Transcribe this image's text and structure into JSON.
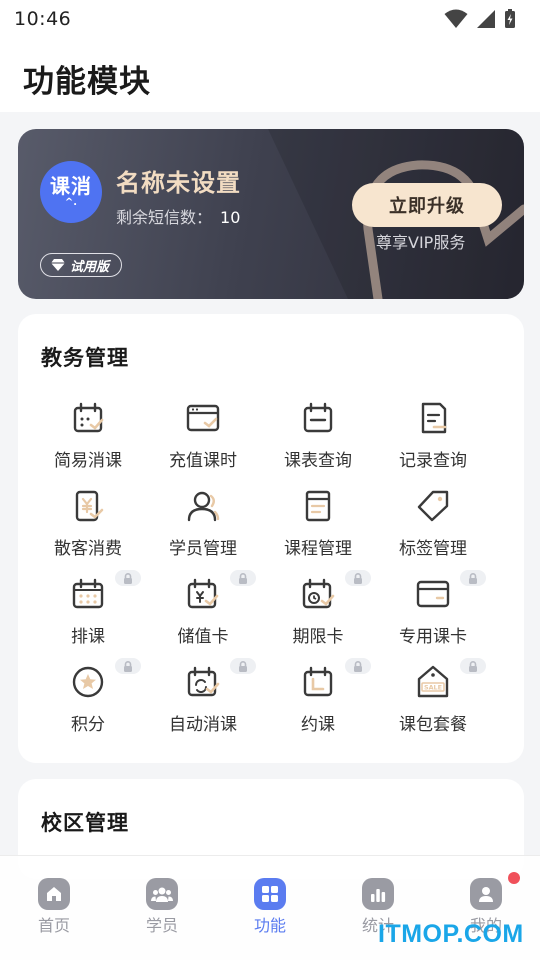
{
  "status_bar": {
    "time": "10:46"
  },
  "header": {
    "title": "功能模块"
  },
  "vip_card": {
    "logo_text": "课消",
    "logo_mark": "^.",
    "name": "名称未设置",
    "sms_label": "剩余短信数：",
    "sms_count": "10",
    "trial_label": "试用版",
    "upgrade_label": "立即升级",
    "upgrade_sub": "尊享VIP服务"
  },
  "academic": {
    "title": "教务管理",
    "items": [
      {
        "label": "简易消课",
        "icon": "calendar-check-icon",
        "locked": false
      },
      {
        "label": "充值课时",
        "icon": "window-check-icon",
        "locked": false
      },
      {
        "label": "课表查询",
        "icon": "calendar-icon",
        "locked": false
      },
      {
        "label": "记录查询",
        "icon": "document-icon",
        "locked": false
      },
      {
        "label": "散客消费",
        "icon": "yen-receipt-icon",
        "locked": false
      },
      {
        "label": "学员管理",
        "icon": "user-icon",
        "locked": false
      },
      {
        "label": "课程管理",
        "icon": "book-icon",
        "locked": false
      },
      {
        "label": "标签管理",
        "icon": "tag-icon",
        "locked": false
      },
      {
        "label": "排课",
        "icon": "schedule-grid-icon",
        "locked": true
      },
      {
        "label": "储值卡",
        "icon": "yen-calendar-icon",
        "locked": true
      },
      {
        "label": "期限卡",
        "icon": "clock-calendar-icon",
        "locked": true
      },
      {
        "label": "专用课卡",
        "icon": "card-icon",
        "locked": true
      },
      {
        "label": "积分",
        "icon": "star-circle-icon",
        "locked": true
      },
      {
        "label": "自动消课",
        "icon": "auto-calendar-icon",
        "locked": true
      },
      {
        "label": "约课",
        "icon": "booking-calendar-icon",
        "locked": true
      },
      {
        "label": "课包套餐",
        "icon": "sale-tag-icon",
        "locked": true
      }
    ]
  },
  "campus": {
    "title": "校区管理"
  },
  "tab_bar": {
    "tabs": [
      {
        "label": "首页",
        "icon": "home-icon",
        "active": false
      },
      {
        "label": "学员",
        "icon": "users-icon",
        "active": false
      },
      {
        "label": "功能",
        "icon": "grid-icon",
        "active": true
      },
      {
        "label": "统计",
        "icon": "bar-chart-icon",
        "active": false
      },
      {
        "label": "我的",
        "icon": "profile-icon",
        "active": false
      }
    ]
  },
  "watermark": "ITMOP.COM",
  "colors": {
    "accent": "#5b7cf0",
    "gold": "#f7e5cf",
    "icon_dark": "#3a3a3a",
    "icon_accent": "#e8c9a6"
  }
}
